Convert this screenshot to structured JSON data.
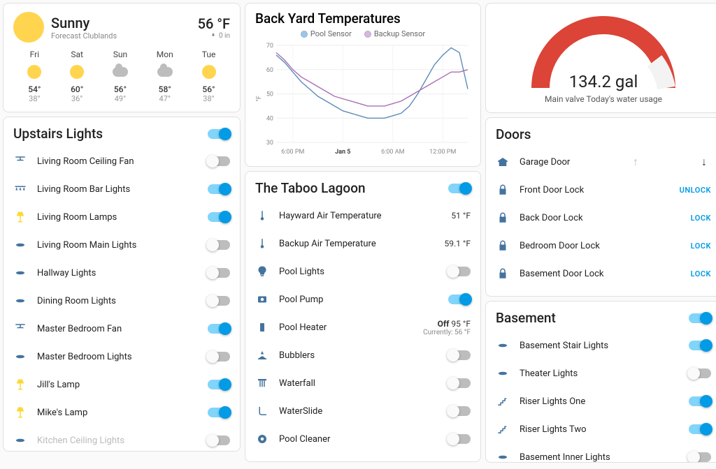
{
  "weather": {
    "condition": "Sunny",
    "location": "Forecast Clublands",
    "temp": "56 °F",
    "precip": "0 in",
    "forecast": [
      {
        "day": "Fri",
        "icon": "sun",
        "hi": "54°",
        "lo": "38°"
      },
      {
        "day": "Sat",
        "icon": "sun",
        "hi": "60°",
        "lo": "36°"
      },
      {
        "day": "Sun",
        "icon": "cloud",
        "hi": "56°",
        "lo": "49°"
      },
      {
        "day": "Mon",
        "icon": "cloud",
        "hi": "58°",
        "lo": "47°"
      },
      {
        "day": "Tue",
        "icon": "sun",
        "hi": "56°",
        "lo": "38°"
      }
    ]
  },
  "upstairs": {
    "title": "Upstairs Lights",
    "master_on": true,
    "items": [
      {
        "name": "Living Room Ceiling Fan",
        "icon": "fan",
        "on": false
      },
      {
        "name": "Living Room Bar Lights",
        "icon": "track",
        "on": true
      },
      {
        "name": "Living Room Lamps",
        "icon": "lamp",
        "on": true
      },
      {
        "name": "Living Room Main Lights",
        "icon": "light",
        "on": false
      },
      {
        "name": "Hallway Lights",
        "icon": "light",
        "on": false
      },
      {
        "name": "Dining Room Lights",
        "icon": "light",
        "on": false
      },
      {
        "name": "Master Bedroom Fan",
        "icon": "fan",
        "on": true
      },
      {
        "name": "Master Bedroom Lights",
        "icon": "light",
        "on": false
      },
      {
        "name": "Jill's Lamp",
        "icon": "lamp",
        "on": true
      },
      {
        "name": "Mike's Lamp",
        "icon": "lamp",
        "on": true
      },
      {
        "name": "Kitchen Ceiling Lights",
        "icon": "light",
        "on": false
      }
    ]
  },
  "backyard_chart": {
    "title": "Back Yard Temperatures",
    "legend": [
      "Pool Sensor",
      "Backup Sensor"
    ],
    "ylabel": "°F"
  },
  "taboo": {
    "title": "The Taboo Lagoon",
    "master_on": true,
    "items": [
      {
        "name": "Hayward Air Temperature",
        "icon": "therm",
        "type": "value",
        "value": "51 °F"
      },
      {
        "name": "Backup Air Temperature",
        "icon": "therm",
        "type": "value",
        "value": "59.1 °F"
      },
      {
        "name": "Pool Lights",
        "icon": "bulb",
        "type": "toggle",
        "on": false
      },
      {
        "name": "Pool Pump",
        "icon": "pump",
        "type": "toggle",
        "on": true
      },
      {
        "name": "Pool Heater",
        "icon": "heater",
        "type": "value2",
        "value": "Off 95 °F",
        "sub": "Currently: 56 °F"
      },
      {
        "name": "Bubblers",
        "icon": "bubbler",
        "type": "toggle",
        "on": false
      },
      {
        "name": "Waterfall",
        "icon": "waterfall",
        "type": "toggle",
        "on": false
      },
      {
        "name": "WaterSlide",
        "icon": "slide",
        "type": "toggle",
        "on": false
      },
      {
        "name": "Pool Cleaner",
        "icon": "cleaner",
        "type": "toggle",
        "on": false
      }
    ]
  },
  "gauge": {
    "value": "134.2 gal",
    "label": "Main valve Today's water usage"
  },
  "doors": {
    "title": "Doors",
    "items": [
      {
        "name": "Garage Door",
        "icon": "garage",
        "type": "garage"
      },
      {
        "name": "Front Door Lock",
        "icon": "lock",
        "type": "lock",
        "action": "UNLOCK"
      },
      {
        "name": "Back Door Lock",
        "icon": "lock",
        "type": "lock",
        "action": "LOCK"
      },
      {
        "name": "Bedroom Door Lock",
        "icon": "lock",
        "type": "lock",
        "action": "LOCK"
      },
      {
        "name": "Basement Door Lock",
        "icon": "lock",
        "type": "lock",
        "action": "LOCK"
      }
    ]
  },
  "basement": {
    "title": "Basement",
    "master_on": true,
    "items": [
      {
        "name": "Basement Stair Lights",
        "icon": "light",
        "on": true
      },
      {
        "name": "Theater Lights",
        "icon": "light",
        "on": false
      },
      {
        "name": "Riser Lights One",
        "icon": "stair",
        "on": true
      },
      {
        "name": "Riser Lights Two",
        "icon": "stair",
        "on": true
      },
      {
        "name": "Basement Inner Lights",
        "icon": "light",
        "on": false
      }
    ]
  },
  "chart_data": {
    "type": "line",
    "title": "Back Yard Temperatures",
    "xlabel": "",
    "ylabel": "°F",
    "ylim": [
      30,
      70
    ],
    "x_ticks": [
      "6:00 PM",
      "Jan 5",
      "6:00 AM",
      "12:00 PM"
    ],
    "x": [
      0,
      1,
      2,
      3,
      4,
      5,
      6,
      7,
      8,
      9,
      10,
      11,
      12,
      13,
      14,
      15,
      16,
      17,
      18,
      19,
      20,
      21,
      22,
      23
    ],
    "series": [
      {
        "name": "Pool Sensor",
        "color": "#5b8db8",
        "values": [
          66,
          63,
          59,
          55,
          52,
          49,
          47,
          45,
          43,
          42,
          41,
          40,
          40,
          40,
          41,
          42,
          45,
          50,
          56,
          62,
          66,
          69,
          67,
          52
        ]
      },
      {
        "name": "Backup Sensor",
        "color": "#a96fb5",
        "values": [
          67,
          64,
          60,
          57,
          55,
          53,
          51,
          49,
          48,
          47,
          46,
          45,
          45,
          45,
          46,
          47,
          49,
          51,
          53,
          55,
          57,
          59,
          59,
          60
        ]
      }
    ]
  }
}
